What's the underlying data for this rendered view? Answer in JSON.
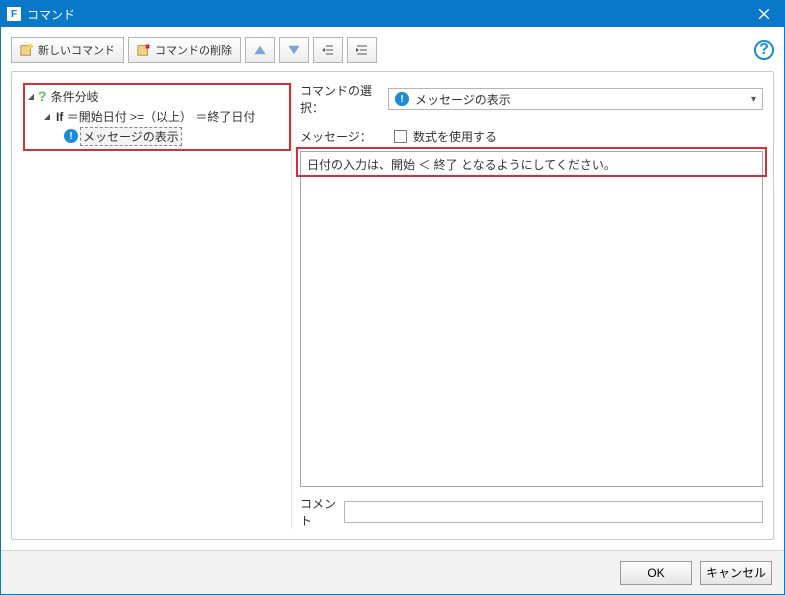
{
  "titlebar": {
    "title": "コマンド",
    "icon_letter": "F"
  },
  "toolbar": {
    "new_command": "新しいコマンド",
    "delete_command": "コマンドの削除"
  },
  "tree": {
    "root_label": "条件分岐",
    "if_prefix": "If",
    "if_expr": "＝開始日付 >=（以上） ＝終了日付",
    "leaf_label": "メッセージの表示"
  },
  "right": {
    "select_label": "コマンドの選択：",
    "select_value": "メッセージの表示",
    "message_label": "メッセージ：",
    "use_formula_label": "数式を使用する",
    "message_value": "日付の入力は、開始 ＜ 終了 となるようにしてください。",
    "comment_label": "コメント",
    "comment_value": ""
  },
  "footer": {
    "ok": "OK",
    "cancel": "キャンセル"
  }
}
